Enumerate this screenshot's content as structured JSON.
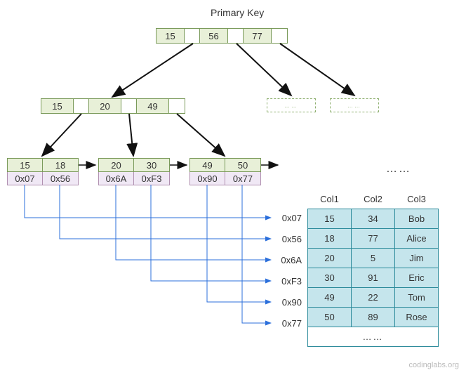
{
  "title": "Primary Key",
  "root": {
    "cells": [
      "15",
      "",
      "56",
      "",
      "77",
      ""
    ]
  },
  "level2": {
    "cells": [
      "15",
      "",
      "20",
      "",
      "49",
      ""
    ]
  },
  "leaves": [
    {
      "keys": [
        "15",
        "18"
      ],
      "ptrs": [
        "0x07",
        "0x56"
      ]
    },
    {
      "keys": [
        "20",
        "30"
      ],
      "ptrs": [
        "0x6A",
        "0xF3"
      ]
    },
    {
      "keys": [
        "49",
        "50"
      ],
      "ptrs": [
        "0x90",
        "0x77"
      ]
    }
  ],
  "leaf_ellipsis": "……",
  "ghosts": [
    "……",
    "……"
  ],
  "pointer_labels": [
    "0x07",
    "0x56",
    "0x6A",
    "0xF3",
    "0x90",
    "0x77"
  ],
  "table": {
    "headers": [
      "Col1",
      "Col2",
      "Col3"
    ],
    "rows": [
      [
        "15",
        "34",
        "Bob"
      ],
      [
        "18",
        "77",
        "Alice"
      ],
      [
        "20",
        "5",
        "Jim"
      ],
      [
        "30",
        "91",
        "Eric"
      ],
      [
        "49",
        "22",
        "Tom"
      ],
      [
        "50",
        "89",
        "Rose"
      ]
    ],
    "footer": "……"
  },
  "watermark": "codinglabs.org",
  "colors": {
    "node_fill": "#e8f0d8",
    "node_border": "#7a9a5a",
    "ptr_fill": "#f0e8f5",
    "ptr_border": "#b090b0",
    "table_border": "#2b8a9a",
    "table_fill": "#c5e5ec",
    "arrow_blue": "#2b6fdb"
  }
}
